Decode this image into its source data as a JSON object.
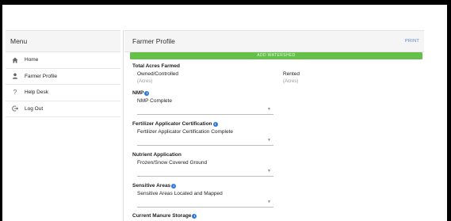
{
  "sidebar": {
    "title": "Menu",
    "items": [
      {
        "label": "Home",
        "icon": "home-icon"
      },
      {
        "label": "Farmer Profile",
        "icon": "person-icon"
      },
      {
        "label": "Help Desk",
        "icon": "question-icon"
      },
      {
        "label": "Log Out",
        "icon": "logout-icon"
      }
    ]
  },
  "main": {
    "title": "Farmer Profile",
    "print_label": "PRINT",
    "add_watershed_label": "ADD WATERSHED",
    "total_acres": {
      "title": "Total Acres Farmed",
      "owned_label": "Owned/Controlled",
      "owned_placeholder": "(Acres)",
      "rented_label": "Rented",
      "rented_placeholder": "(Acres)"
    },
    "nmp": {
      "title": "NMP",
      "value": "NMP Complete"
    },
    "fertilizer": {
      "title": "Fertilizer Applicator Certification",
      "value": "Fertilizer Applicator Certification Complete"
    },
    "nutrient": {
      "title": "Nutrient Application",
      "value": "Frozen/Snow Covered Ground"
    },
    "sensitive": {
      "title": "Sensitive Areas",
      "value": "Sensitive Areas Located and Mapped"
    },
    "manure": {
      "title": "Current Manure Storage"
    }
  },
  "colors": {
    "accent": "#4a7fd4",
    "green": "#65c04a",
    "info": "#2e78e0"
  }
}
